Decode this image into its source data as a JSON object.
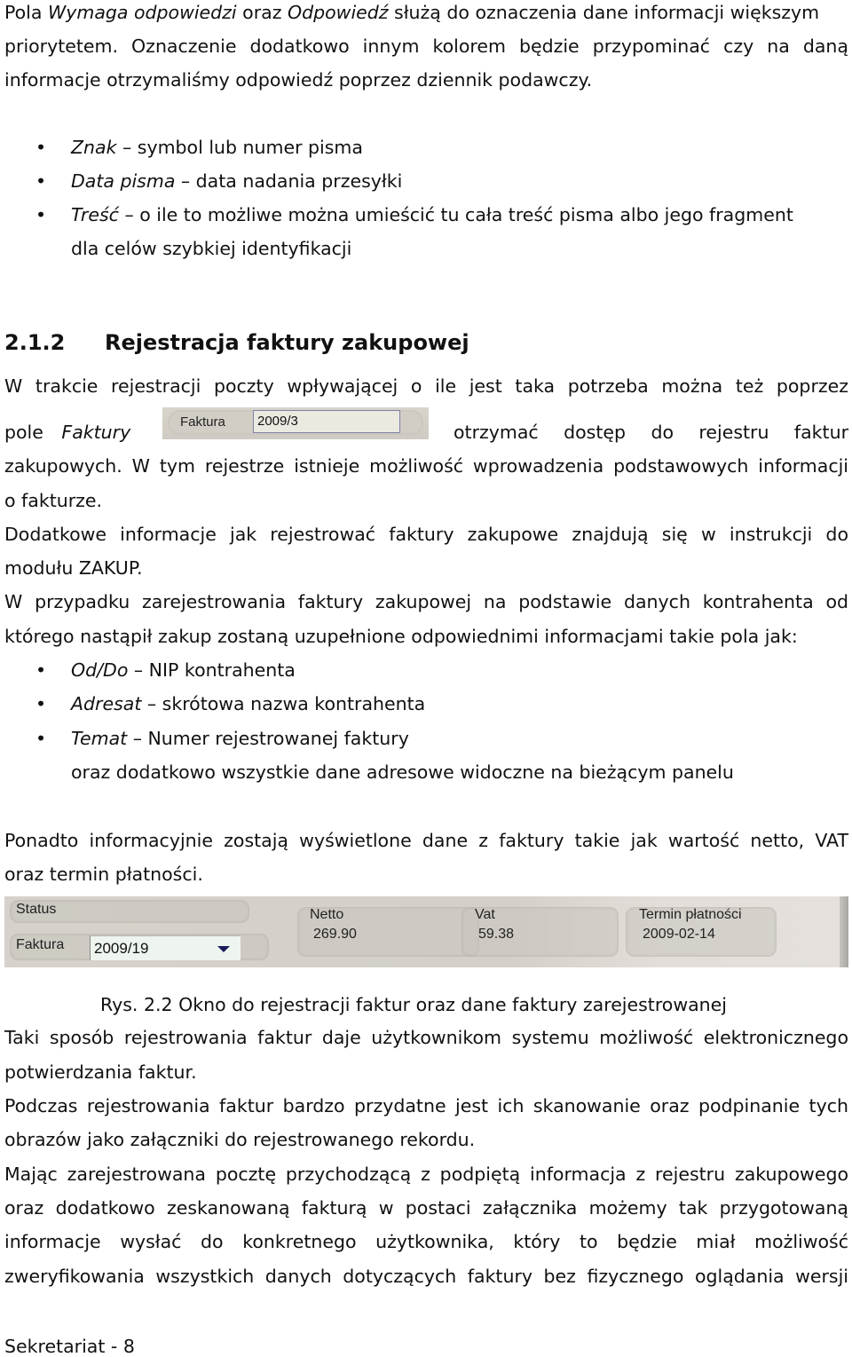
{
  "intro": {
    "line1": {
      "a": "Pola ",
      "b_italic": "Wymaga odpowiedzi",
      "c": " oraz ",
      "d_italic": "Odpowiedź",
      "e": " służą do  oznaczenia dane informacji większym"
    },
    "line2": "priorytetem. Oznaczenie  dodatkowo innym kolorem będzie przypominać czy na daną",
    "line3": "informacje otrzymaliśmy odpowiedź poprzez dziennik podawczy."
  },
  "bullets1": [
    {
      "term": "Znak",
      "desc": " – symbol lub numer pisma"
    },
    {
      "term": "Data pisma",
      "desc": " – data nadania przesyłki"
    },
    {
      "term": "Treść",
      "desc": " – o ile to możliwe można umieścić tu  cała treść  pisma albo jego fragment"
    }
  ],
  "bullets1_cont": "dla celów szybkiej identyfikacji",
  "section": {
    "number": "2.1.2",
    "title": "Rejestracja faktury zakupowej"
  },
  "para1": {
    "line1": "W trakcie rejestracji  poczty wpływającej o ile  jest taka potrzeba można  też  poprzez",
    "line2_pre": "pole",
    "line2_italic": "Faktury",
    "line2_post": "otrzymać  dostęp  do  rejestru  faktur",
    "line3": "zakupowych. W tym rejestrze istnieje możliwość wprowadzenia  podstawowych informacji",
    "line4": "o fakturze."
  },
  "faktura_widget": {
    "label": "Faktura",
    "value": "2009/3"
  },
  "para2": {
    "line1": "Dodatkowe informacje jak rejestrować faktury zakupowe znajdują się w instrukcji do",
    "line2": "modułu ZAKUP."
  },
  "para3": {
    "line1": "W przypadku zarejestrowania  faktury zakupowej na podstawie danych kontrahenta od",
    "line2": "którego nastąpił zakup zostaną uzupełnione odpowiednimi informacjami takie pola jak:"
  },
  "bullets2": [
    {
      "term": "Od/Do",
      "desc": " – NIP kontrahenta"
    },
    {
      "term": "Adresat",
      "desc": " – skrótowa nazwa kontrahenta"
    },
    {
      "term": "Temat",
      "desc": " – Numer  rejestrowanej faktury"
    }
  ],
  "bullets2_cont": "oraz dodatkowo wszystkie dane adresowe widoczne na  bieżącym panelu",
  "para4": {
    "line1": "Ponadto informacyjnie zostają wyświetlone dane z faktury takie jak wartość netto, VAT",
    "line2": "oraz termin płatności."
  },
  "panel": {
    "status_label": "Status",
    "faktura_label": "Faktura",
    "faktura_value": "2009/19",
    "netto_label": "Netto",
    "netto_value": "269.90",
    "vat_label": "Vat",
    "vat_value": "59.38",
    "termin_label": "Termin płatności",
    "termin_value": "2009-02-14"
  },
  "caption": "Rys. 2.2 Okno do rejestracji faktur oraz dane faktury zarejestrowanej",
  "para5": {
    "line1": "Taki sposób rejestrowania faktur daje użytkownikom systemu  możliwość elektronicznego",
    "line2": "potwierdzania faktur."
  },
  "para6": {
    "line1": "Podczas rejestrowania faktur bardzo przydatne jest ich skanowanie oraz podpinanie tych",
    "line2": "obrazów jako załączniki do  rejestrowanego rekordu."
  },
  "para7": {
    "line1": "Mając zarejestrowana pocztę przychodzącą z podpiętą informacja z rejestru zakupowego",
    "line2": "oraz dodatkowo zeskanowaną fakturą w postaci załącznika możemy tak przygotowaną",
    "line3": "informacje wysłać do konkretnego użytkownika, który to będzie miał możliwość",
    "line4": "zweryfikowania wszystkich danych dotyczących faktury bez  fizycznego oglądania wersji"
  },
  "footer": "Sekretariat -  8",
  "bullet_glyph": "•"
}
